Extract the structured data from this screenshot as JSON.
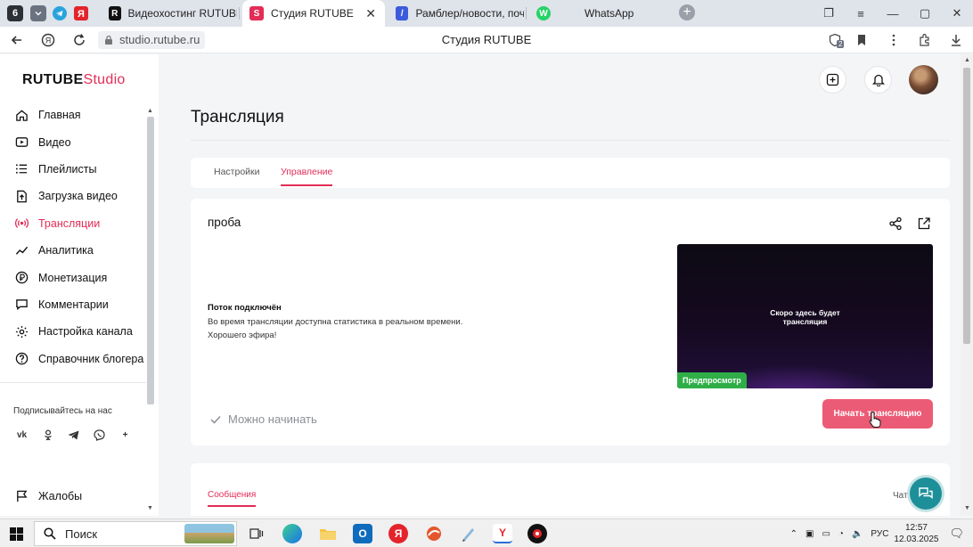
{
  "browser": {
    "tab_count": "6",
    "tabs": [
      {
        "title": "Видеохостинг RUTUBE. С",
        "favicon": "R",
        "color": "#111111"
      },
      {
        "title": "Студия RUTUBE",
        "favicon": "S",
        "color": "#e32d56"
      },
      {
        "title": "Рамблер/новости, почта",
        "favicon": "/",
        "color": "#3b5bdb"
      },
      {
        "title": "WhatsApp",
        "favicon": "W",
        "color": "#25d366"
      }
    ],
    "address": "studio.rutube.ru",
    "page_title": "Студия RUTUBE",
    "badge_count": "2"
  },
  "sidebar": {
    "logo_main": "RUTUBE",
    "logo_studio": "Studio",
    "items": [
      {
        "label": "Главная",
        "icon": "home-icon"
      },
      {
        "label": "Видео",
        "icon": "video-icon"
      },
      {
        "label": "Плейлисты",
        "icon": "playlist-icon"
      },
      {
        "label": "Загрузка видео",
        "icon": "upload-icon"
      },
      {
        "label": "Трансляции",
        "icon": "broadcast-icon"
      },
      {
        "label": "Аналитика",
        "icon": "analytics-icon"
      },
      {
        "label": "Монетизация",
        "icon": "monetization-icon"
      },
      {
        "label": "Комментарии",
        "icon": "comments-icon"
      },
      {
        "label": "Настройка канала",
        "icon": "channel-settings-icon"
      },
      {
        "label": "Справочник блогера",
        "icon": "help-icon"
      }
    ],
    "subscribe_label": "Подписывайтесь на нас",
    "complaints": "Жалобы"
  },
  "main": {
    "title": "Трансляция",
    "tabs": [
      {
        "label": "Настройки"
      },
      {
        "label": "Управление"
      }
    ],
    "stream": {
      "name": "проба",
      "status_title": "Поток подключён",
      "status_line1": "Во время трансляции доступна статистика в реальном времени.",
      "status_line2": "Хорошего эфира!",
      "preview_text_1": "Скоро здесь будет",
      "preview_text_2": "трансляция",
      "preview_badge": "Предпросмотр",
      "ready_label": "Можно начинать",
      "start_button": "Начать трансляцию"
    },
    "messages_tab": "Сообщения",
    "chat_label": "Чат"
  },
  "taskbar": {
    "search_label": "Поиск",
    "language": "РУС",
    "time": "12:57",
    "date": "12.03.2025"
  },
  "colors": {
    "accent": "#e32d56",
    "start_button": "#ec5b75",
    "preview_badge": "#2fae48",
    "fab": "#1d8f99"
  }
}
